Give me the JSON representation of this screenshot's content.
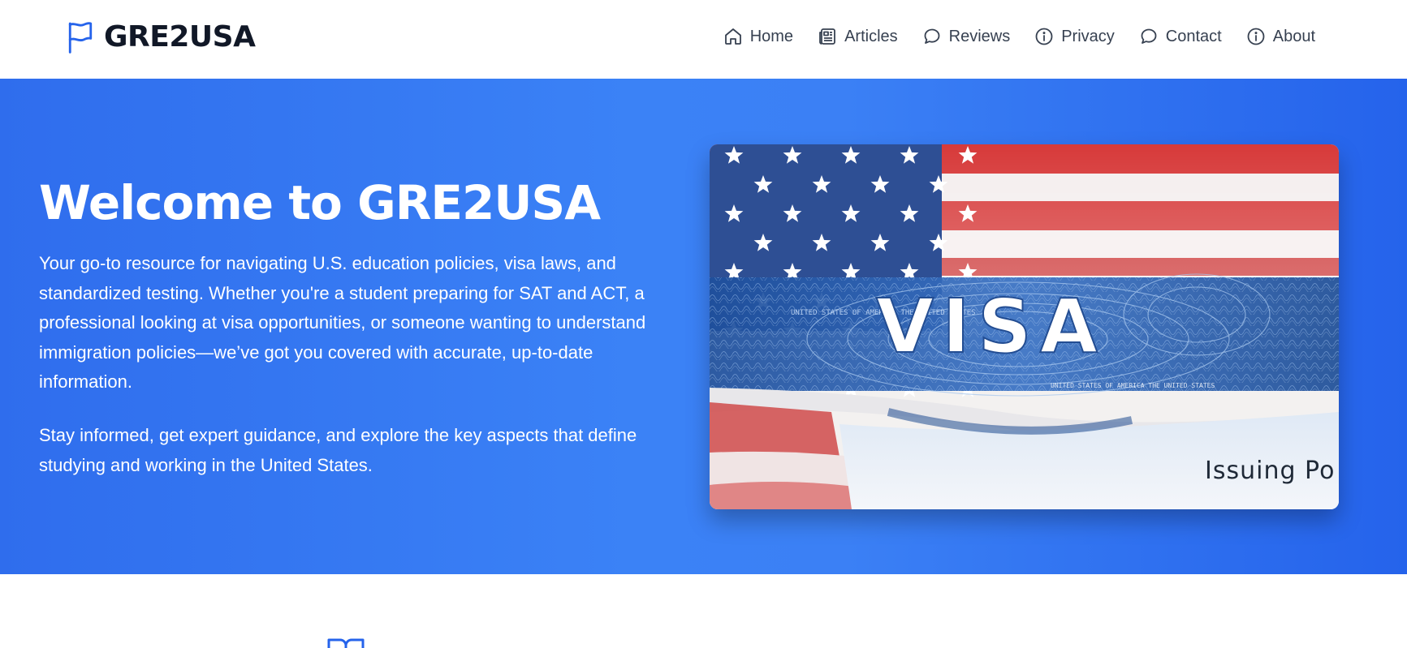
{
  "brand": {
    "name": "GRE2USA",
    "icon": "flag-icon"
  },
  "nav": [
    {
      "label": "Home",
      "icon": "home-icon"
    },
    {
      "label": "Articles",
      "icon": "newspaper-icon"
    },
    {
      "label": "Reviews",
      "icon": "chat-bubble-icon"
    },
    {
      "label": "Privacy",
      "icon": "info-circle-icon"
    },
    {
      "label": "Contact",
      "icon": "chat-bubble-icon"
    },
    {
      "label": "About",
      "icon": "info-circle-icon"
    }
  ],
  "hero": {
    "title": "Welcome to GRE2USA",
    "paragraph1": "Your go-to resource for navigating U.S. education policies, visa laws, and standardized testing. Whether you're a student preparing for SAT and ACT, a professional looking at visa opportunities, or someone wanting to understand immigration policies—we’ve got you covered with accurate, up-to-date information.",
    "paragraph2": "Stay informed, get expert guidance, and explore the key aspects that define studying and working in the United States.",
    "image": {
      "visa_text": "VISA",
      "issuing_text": "Issuing Po",
      "microprint_text": "UNITED STATES OF AMERICA THE UNITED STATES"
    }
  },
  "section_icon": "book-icon",
  "colors": {
    "accent": "#2563eb",
    "hero_gradient_start": "#2f6ded",
    "hero_gradient_mid": "#3b82f6",
    "hero_gradient_end": "#2563eb",
    "text_dark": "#111827",
    "nav_text": "#374151"
  }
}
